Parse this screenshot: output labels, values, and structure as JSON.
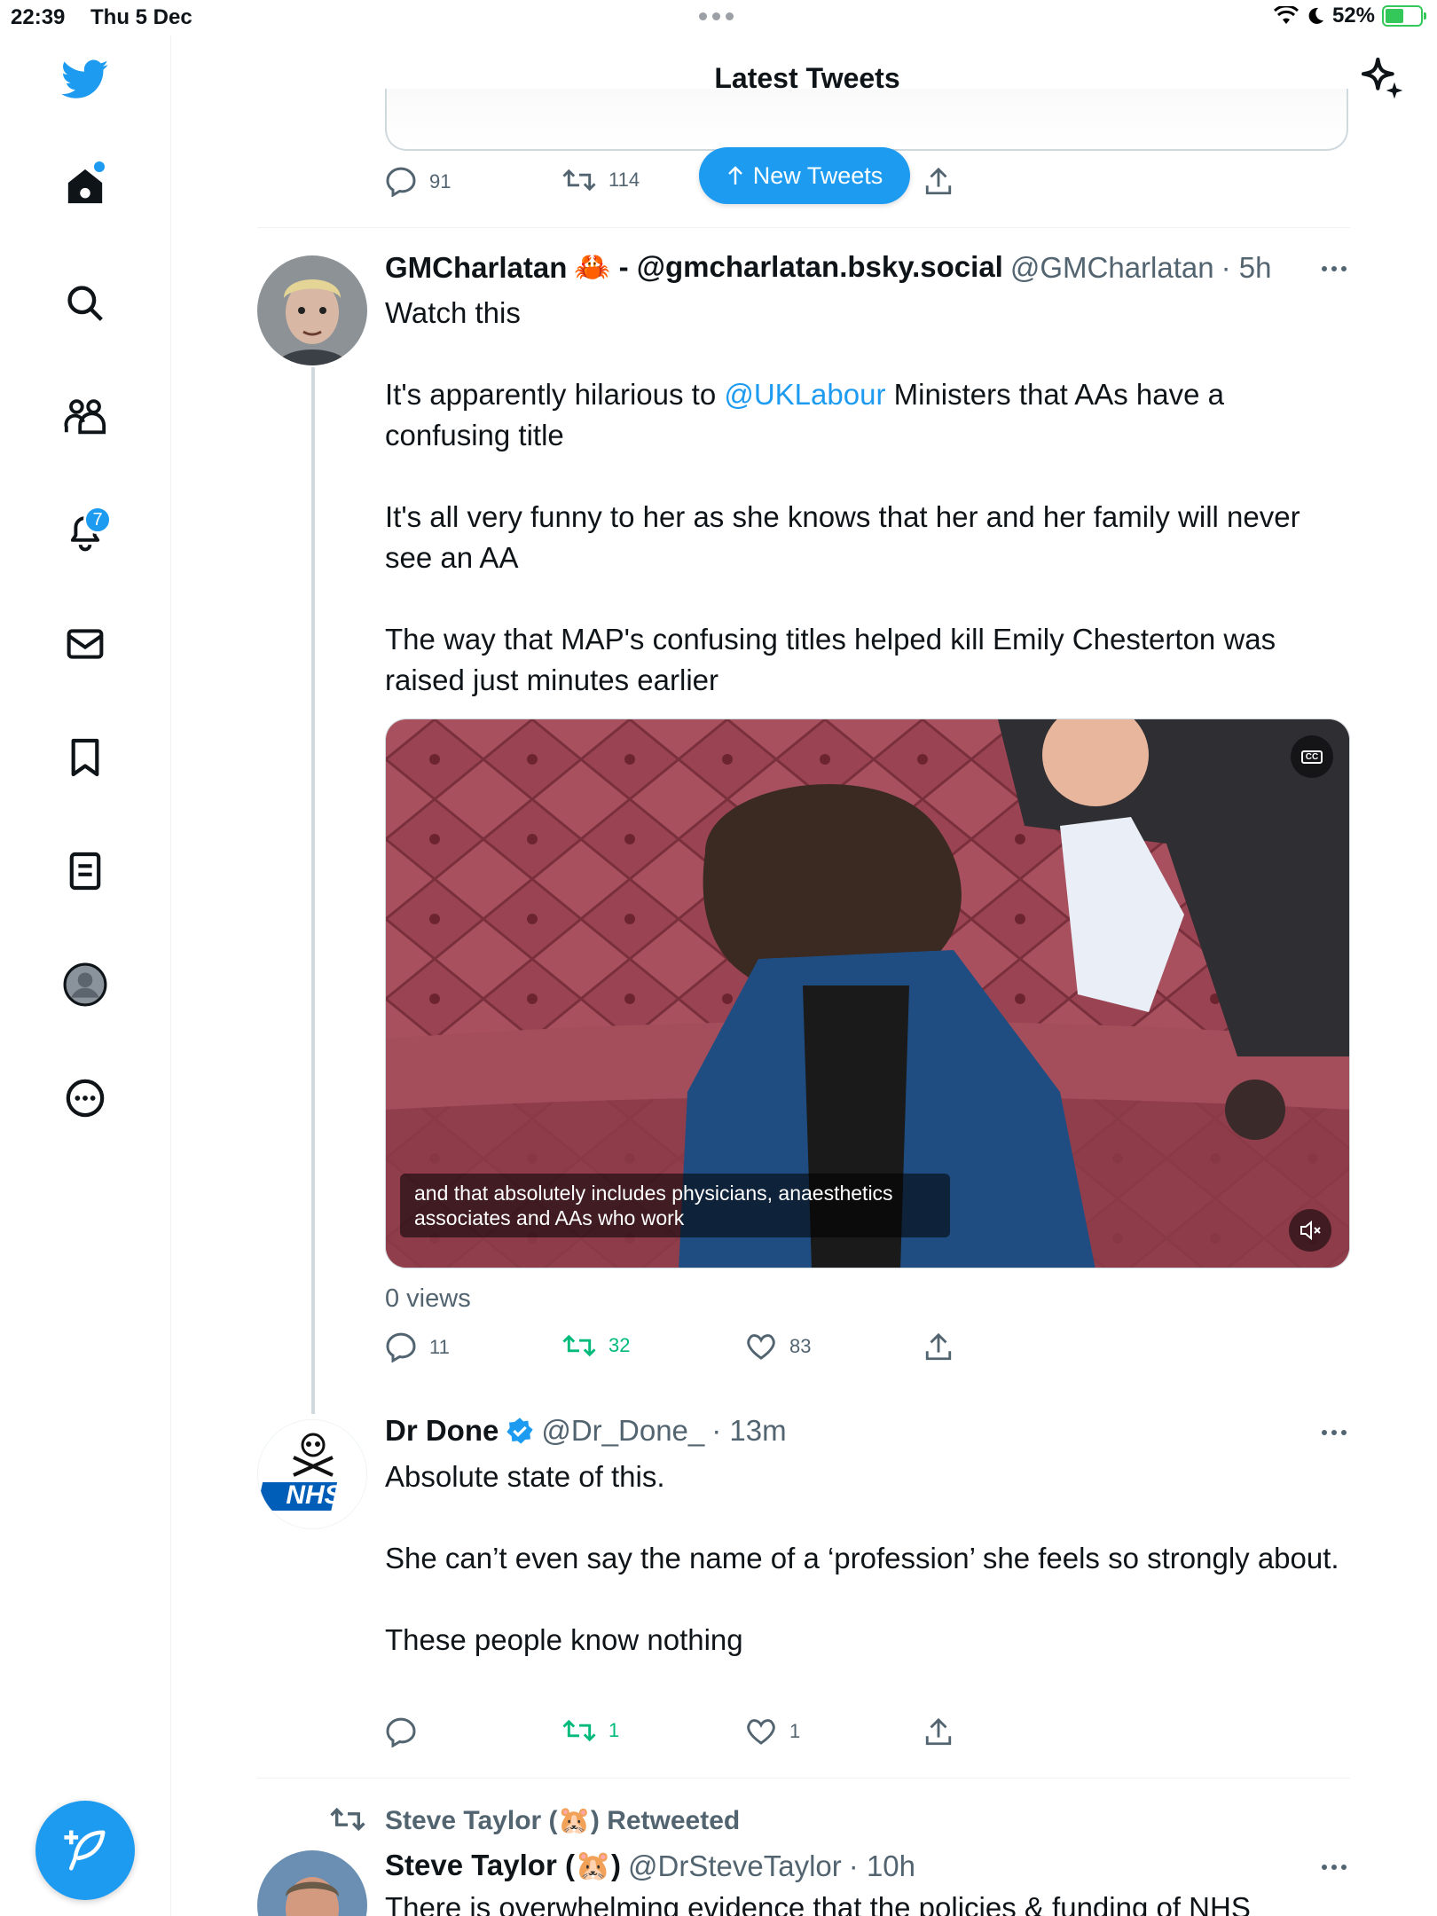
{
  "status_bar": {
    "time": "22:39",
    "date": "Thu 5 Dec",
    "battery": "52%",
    "battery_level": 0.52
  },
  "header": {
    "title": "Latest Tweets"
  },
  "sidebar": {
    "items": [
      {
        "icon": "home-icon"
      },
      {
        "icon": "search-icon"
      },
      {
        "icon": "communities-icon"
      },
      {
        "icon": "notifications-icon",
        "badge": "7"
      },
      {
        "icon": "messages-icon"
      },
      {
        "icon": "bookmarks-icon"
      },
      {
        "icon": "lists-icon"
      },
      {
        "icon": "profile-icon"
      },
      {
        "icon": "more-icon"
      }
    ]
  },
  "previous_tweet": {
    "replies": "91",
    "retweets": "114"
  },
  "new_tweets_pill": {
    "label": "New Tweets"
  },
  "tweet1": {
    "name": "GMCharlatan",
    "name_suffix": "🦀 - @gmcharlatan.bsky.social",
    "handle": "@GMCharlatan",
    "time": "· 5h",
    "line1": "Watch this",
    "line2a": "It's apparently hilarious to ",
    "mention": "@UKLabour",
    "line2b": " Ministers that AAs have a confusing title",
    "line3": "It's all very funny to her as she knows that her and her family will never see an AA",
    "line4": "The way that MAP's confusing titles helped kill Emily Chesterton was raised just minutes earlier",
    "video_caption": "and that absolutely includes physicians, anaesthetics associates and AAs who work",
    "views": "0 views",
    "replies": "11",
    "retweets": "32",
    "likes": "83"
  },
  "tweet2": {
    "name": "Dr Done",
    "handle": "@Dr_Done_",
    "time": "· 13m",
    "avatar_text": "NHS",
    "line1": "Absolute state of this.",
    "line2": "She can’t even say the name of a ‘profession’ she feels so strongly about.",
    "line3": "These people know nothing",
    "retweets": "1",
    "likes": "1"
  },
  "tweet3": {
    "retweeted_by": "Steve Taylor (🐹) Retweeted",
    "name": "Steve Taylor (🐹)",
    "handle": "@DrSteveTaylor",
    "time": "· 10h",
    "line1": "There is overwhelming evidence that the policies & funding of NHS"
  },
  "colors": {
    "accent": "#1d9bf0",
    "retweet": "#00ba7c",
    "secondary_text": "#536471"
  }
}
